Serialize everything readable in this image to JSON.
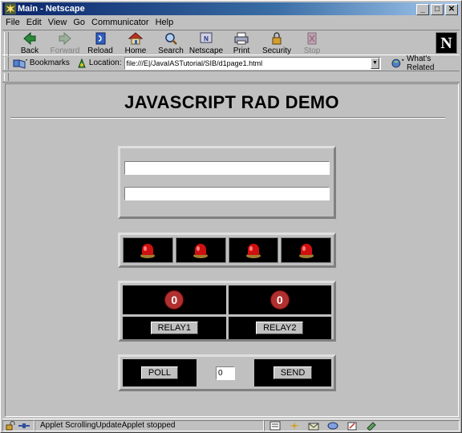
{
  "window": {
    "title": "Main - Netscape",
    "controls": {
      "minimize": "_",
      "maximize": "□",
      "close": "✕"
    }
  },
  "menu": [
    "File",
    "Edit",
    "View",
    "Go",
    "Communicator",
    "Help"
  ],
  "toolbar": {
    "buttons": [
      {
        "label": "Back",
        "icon": "back-arrow-icon",
        "enabled": true
      },
      {
        "label": "Forward",
        "icon": "forward-arrow-icon",
        "enabled": false
      },
      {
        "label": "Reload",
        "icon": "reload-icon",
        "enabled": true
      },
      {
        "label": "Home",
        "icon": "home-icon",
        "enabled": true
      },
      {
        "label": "Search",
        "icon": "search-icon",
        "enabled": true
      },
      {
        "label": "Netscape",
        "icon": "netscape-icon",
        "enabled": true
      },
      {
        "label": "Print",
        "icon": "printer-icon",
        "enabled": true
      },
      {
        "label": "Security",
        "icon": "padlock-icon",
        "enabled": true
      },
      {
        "label": "Stop",
        "icon": "stop-icon",
        "enabled": false
      }
    ],
    "logo": "N"
  },
  "location": {
    "bookmarks_label": "Bookmarks",
    "location_label": "Location:",
    "url": "file:///E|/JavaIASTutorial/SIB/d1page1.html",
    "whats_related": "What's Related"
  },
  "page": {
    "title": "JAVASCRIPT RAD DEMO",
    "text_fields": [
      "",
      ""
    ],
    "leds": [
      {
        "state": "on",
        "color": "#d01010"
      },
      {
        "state": "on",
        "color": "#d01010"
      },
      {
        "state": "on",
        "color": "#d01010"
      },
      {
        "state": "on",
        "color": "#d01010"
      }
    ],
    "relays": [
      {
        "counter": "0",
        "label": "RELAY1"
      },
      {
        "counter": "0",
        "label": "RELAY2"
      }
    ],
    "poll_label": "POLL",
    "send_label": "SEND",
    "value": "0"
  },
  "status": {
    "text": "Applet ScrollingUpdateApplet stopped"
  }
}
